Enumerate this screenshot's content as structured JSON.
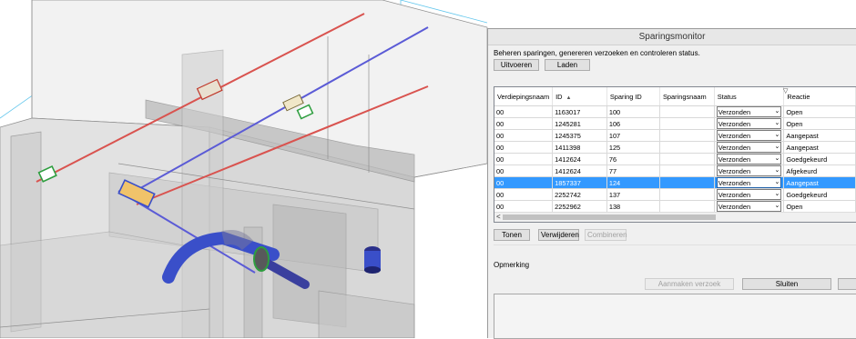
{
  "window": {
    "title": "Sparingsmonitor",
    "description": "Beheren sparingen, genereren verzoeken en controleren status."
  },
  "toolbar": {
    "run_label": "Uitvoeren",
    "load_label": "Laden"
  },
  "table": {
    "columns": {
      "level": "Verdiepingsnaam",
      "id": "ID",
      "opening_id": "Sparing ID",
      "opening_name": "Sparingsnaam",
      "status": "Status",
      "response": "Reactie"
    },
    "rows": [
      {
        "level": "00",
        "id": "1163017",
        "opening_id": "100",
        "opening_name": "",
        "status": "Verzonden",
        "response": "Open"
      },
      {
        "level": "00",
        "id": "1245281",
        "opening_id": "106",
        "opening_name": "",
        "status": "Verzonden",
        "response": "Open"
      },
      {
        "level": "00",
        "id": "1245375",
        "opening_id": "107",
        "opening_name": "",
        "status": "Verzonden",
        "response": "Aangepast"
      },
      {
        "level": "00",
        "id": "1411398",
        "opening_id": "125",
        "opening_name": "",
        "status": "Verzonden",
        "response": "Aangepast"
      },
      {
        "level": "00",
        "id": "1412624",
        "opening_id": "76",
        "opening_name": "",
        "status": "Verzonden",
        "response": "Goedgekeurd"
      },
      {
        "level": "00",
        "id": "1412624",
        "opening_id": "77",
        "opening_name": "",
        "status": "Verzonden",
        "response": "Afgekeurd"
      },
      {
        "level": "00",
        "id": "1857337",
        "opening_id": "124",
        "opening_name": "",
        "status": "Verzonden",
        "response": "Aangepast",
        "selected": true
      },
      {
        "level": "00",
        "id": "2252742",
        "opening_id": "137",
        "opening_name": "",
        "status": "Verzonden",
        "response": "Goedgekeurd"
      },
      {
        "level": "00",
        "id": "2252962",
        "opening_id": "138",
        "opening_name": "",
        "status": "Verzonden",
        "response": "Open"
      }
    ],
    "scroll_left_glyph": "<"
  },
  "actions": {
    "show_label": "Tonen",
    "delete_label": "Verwijderen",
    "combine_label": "Combineren"
  },
  "remark_label": "Opmerking",
  "footer": {
    "create_request_label": "Aanmaken verzoek",
    "close_label": "Sluiten"
  },
  "colors": {
    "selection": "#3399ff",
    "pipe_red": "#d9534f",
    "pipe_blue": "#5b5bd6",
    "duct_blue": "#3a4fc9",
    "guide_cyan": "#59c8ee"
  }
}
